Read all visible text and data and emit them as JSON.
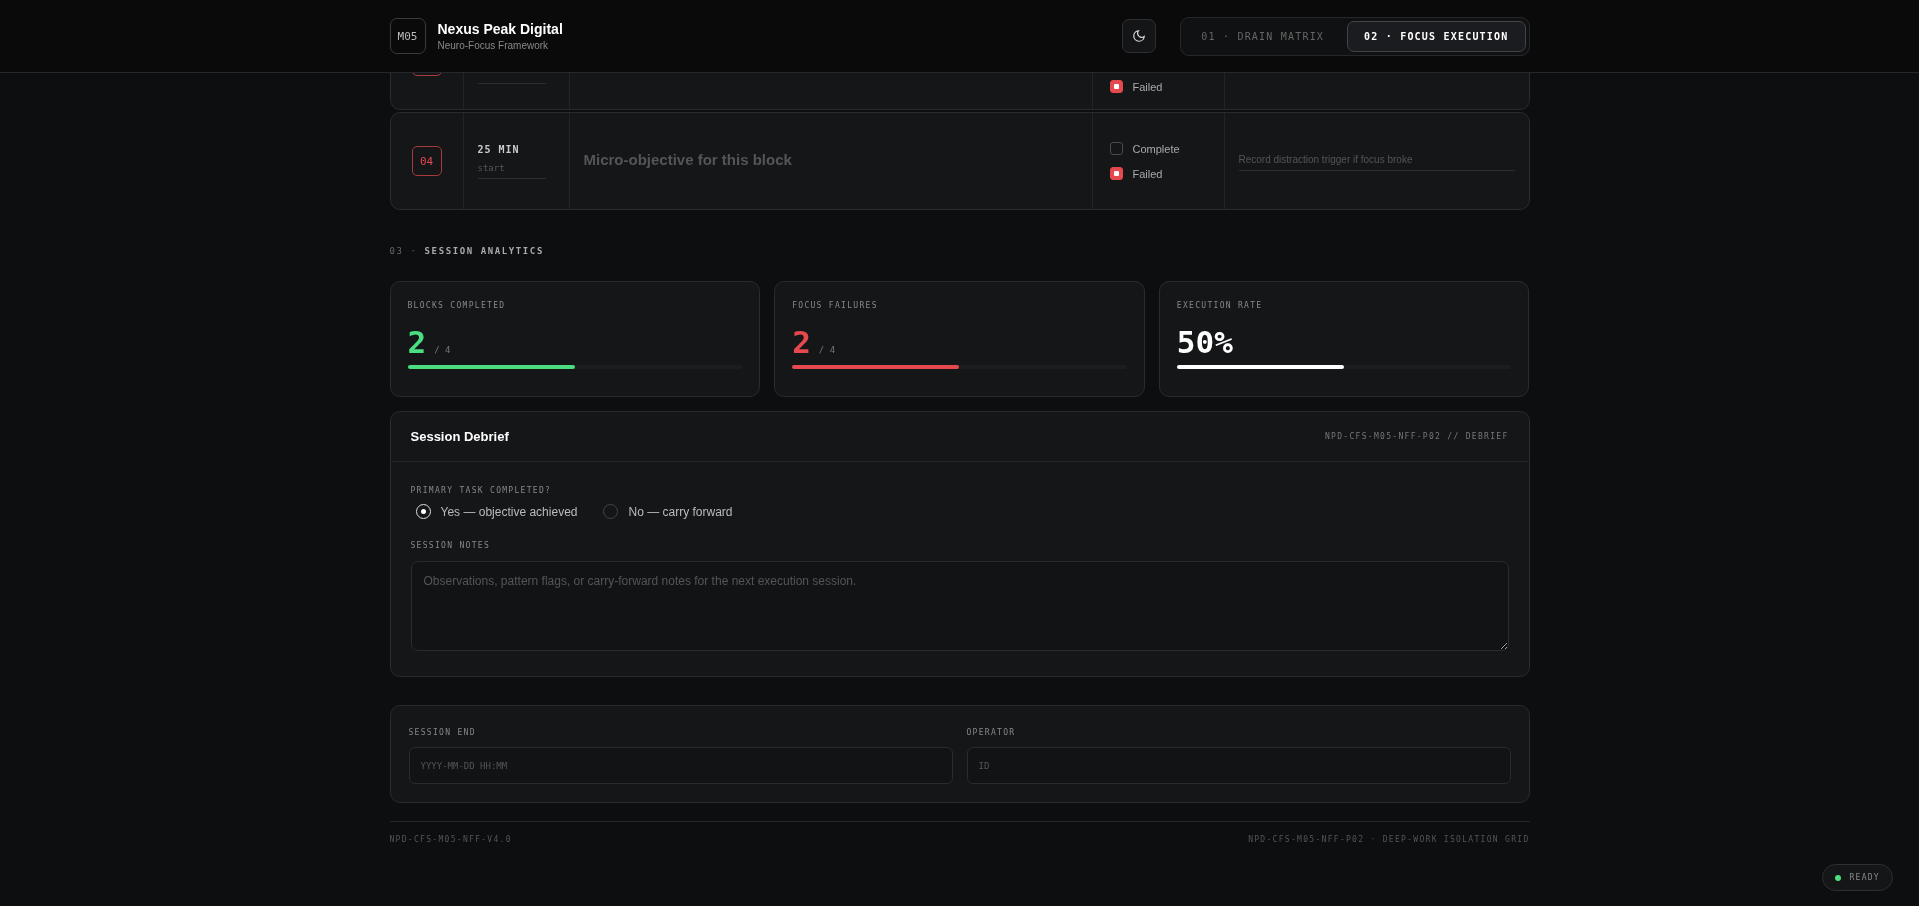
{
  "header": {
    "logo": "M05",
    "title": "Nexus Peak Digital",
    "subtitle": "Neuro-Focus Framework",
    "tabs": [
      {
        "label": "01 · DRAIN MATRIX",
        "selected": false
      },
      {
        "label": "02 · FOCUS EXECUTION",
        "selected": true
      }
    ]
  },
  "blocks": [
    {
      "kind": "partial",
      "checks": [
        {
          "label": "Failed",
          "checked": true
        }
      ]
    },
    {
      "kind": "full",
      "number": "04",
      "duration": "25 MIN",
      "start_placeholder": "start",
      "objective_placeholder": "Micro-objective for this block",
      "checks": [
        {
          "label": "Complete",
          "checked": false
        },
        {
          "label": "Failed",
          "checked": true
        }
      ],
      "notes_placeholder": "Record distraction trigger if focus broke"
    }
  ],
  "analytics": {
    "heading": "03 · **SESSION ANALYTICS**",
    "cards": [
      {
        "label": "BLOCKS COMPLETED",
        "value": "2",
        "total": "/ 4",
        "level": 0.5,
        "color": "#4ade80"
      },
      {
        "label": "FOCUS FAILURES",
        "value": "2",
        "total": "/ 4",
        "level": 0.5,
        "color": "#e5484d"
      },
      {
        "label": "EXECUTION RATE",
        "value": "50%",
        "level": 0.5,
        "color": "#ffffff"
      }
    ]
  },
  "debrief": {
    "title": "Session Debrief",
    "code": "NPD-CFS-M05-NFF-P02 // DEBRIEF",
    "question": "PRIMARY TASK COMPLETED?",
    "options": [
      {
        "label": "Yes — objective achieved",
        "selected": true
      },
      {
        "label": "No — carry forward",
        "selected": false
      }
    ],
    "notes_label": "SESSION NOTES",
    "notes_placeholder": "Observations, pattern flags, or carry-forward notes for the next execution session."
  },
  "signoff": {
    "fields": [
      {
        "label": "SESSION END",
        "placeholder": "YYYY-MM-DD HH:MM"
      },
      {
        "label": "OPERATOR",
        "placeholder": "ID"
      }
    ]
  },
  "footer": {
    "left": "NPD-CFS-M05-NFF-V4.0",
    "right": "NPD-CFS-M05-NFF-P02 · DEEP-WORK ISOLATION GRID"
  },
  "status": {
    "label": "READY"
  }
}
